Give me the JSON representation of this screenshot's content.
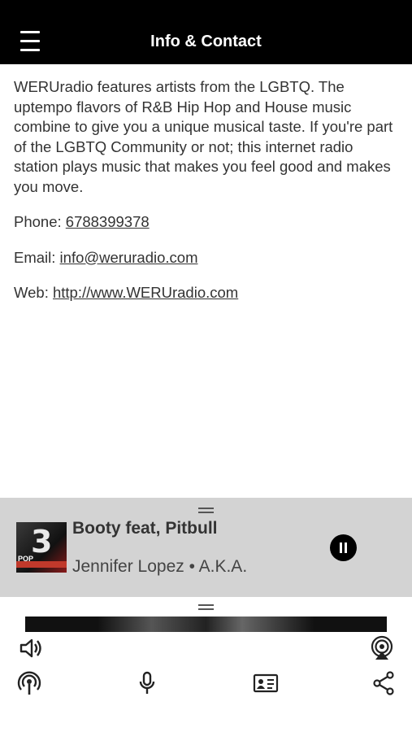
{
  "header": {
    "title": "Info & Contact",
    "menu_icon": "hamburger-menu-icon"
  },
  "content": {
    "description": "WERUradio features artists from the LGBTQ. The uptempo flavors of R&B Hip Hop and House music combine to give you a unique musical taste. If you're part of the LGBTQ Community or not; this internet radio station plays music that makes you feel good and makes you move.",
    "phone_label": "Phone: ",
    "phone_value": "6788399378",
    "email_label": "Email: ",
    "email_value": "info@weruradio.com",
    "web_label": "Web: ",
    "web_value": "http://www.WERUradio.com"
  },
  "player": {
    "song_title": "Booty feat, Pitbull",
    "artist_album": "Jennifer Lopez • A.K.A.",
    "album_art_text": "3",
    "album_art_badge": "POP",
    "state_icon": "pause-icon"
  },
  "toolbar": {
    "icons": [
      "volume-icon",
      "airplay-icon",
      "podcast-icon",
      "microphone-icon",
      "contact-card-icon",
      "share-icon"
    ]
  },
  "colors": {
    "header_bg": "#000000",
    "player_bg": "#d3d3d3"
  }
}
